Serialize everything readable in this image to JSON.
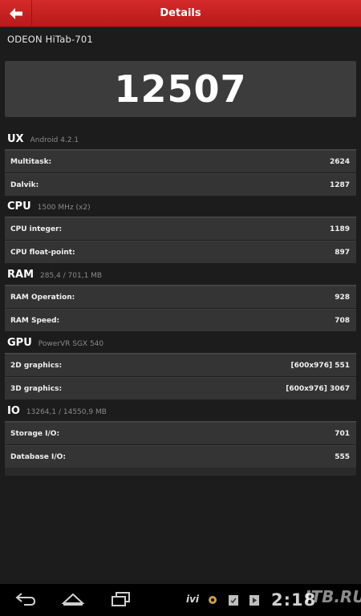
{
  "header": {
    "title": "Details"
  },
  "device": {
    "name": "ODEON HiTab-701"
  },
  "score": {
    "total": "12507"
  },
  "sections": [
    {
      "name": "UX",
      "sub": "Android 4.2.1",
      "rows": [
        {
          "label": "Multitask:",
          "value": "2624"
        },
        {
          "label": "Dalvik:",
          "value": "1287"
        }
      ]
    },
    {
      "name": "CPU",
      "sub": "1500 MHz (x2)",
      "rows": [
        {
          "label": "CPU integer:",
          "value": "1189"
        },
        {
          "label": "CPU float-point:",
          "value": "897"
        }
      ]
    },
    {
      "name": "RAM",
      "sub": "285,4 / 701,1 MB",
      "rows": [
        {
          "label": "RAM Operation:",
          "value": "928"
        },
        {
          "label": "RAM Speed:",
          "value": "708"
        }
      ]
    },
    {
      "name": "GPU",
      "sub": "PowerVR SGX 540",
      "rows": [
        {
          "label": "2D graphics:",
          "value": "[600x976] 551"
        },
        {
          "label": "3D graphics:",
          "value": "[600x976] 3067"
        }
      ]
    },
    {
      "name": "IO",
      "sub": "13264,1 / 14550,9 MB",
      "rows": [
        {
          "label": "Storage I/O:",
          "value": "701"
        },
        {
          "label": "Database I/O:",
          "value": "555"
        }
      ]
    }
  ],
  "navbar": {
    "icons": [
      "back-icon",
      "home-icon",
      "recent-apps-icon"
    ],
    "tray": {
      "app_label": "ivi",
      "time": "2:18"
    },
    "watermark": "ITB.RU"
  },
  "colors": {
    "accent": "#c8201f",
    "row_bg": "#343434",
    "background": "#1c1c1c"
  }
}
